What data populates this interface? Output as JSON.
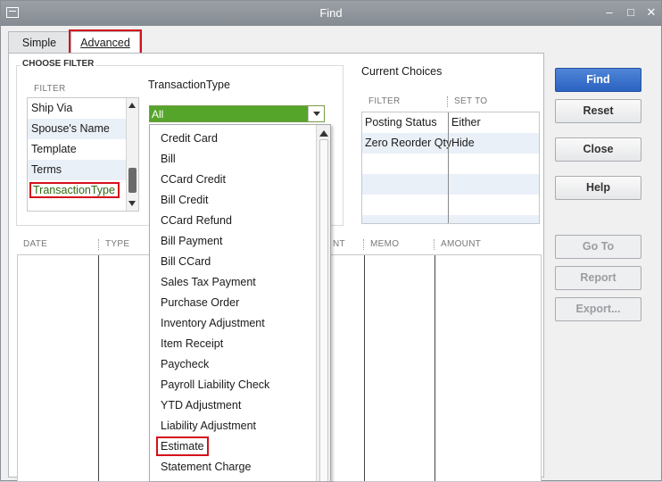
{
  "window": {
    "title": "Find"
  },
  "tabs": [
    {
      "label": "Simple"
    },
    {
      "label": "Advanced"
    }
  ],
  "choose_filter": {
    "group_label": "CHOOSE FILTER",
    "column_header": "FILTER",
    "items": [
      "Ship Via",
      "Spouse's Name",
      "Template",
      "Terms",
      "TransactionType"
    ],
    "selected": "TransactionType"
  },
  "transaction_type": {
    "label": "TransactionType",
    "selected_value": "All",
    "options": [
      "Credit Card",
      "Bill",
      "CCard Credit",
      "Bill Credit",
      "CCard Refund",
      "Bill Payment",
      "Bill CCard",
      "Sales Tax Payment",
      "Purchase Order",
      "Inventory Adjustment",
      "Item Receipt",
      "Paycheck",
      "Payroll Liability Check",
      "YTD Adjustment",
      "Liability Adjustment",
      "Estimate",
      "Statement Charge"
    ],
    "highlighted": "Estimate"
  },
  "current_choices": {
    "label": "Current Choices",
    "headers": {
      "filter": "FILTER",
      "set_to": "SET TO"
    },
    "rows": [
      {
        "filter": "Posting Status",
        "set_to": "Either"
      },
      {
        "filter": "Zero Reorder Qty",
        "set_to": "Hide"
      }
    ]
  },
  "results": {
    "headers": {
      "date": "DATE",
      "type": "TYPE",
      "account": "NT",
      "memo": "MEMO",
      "amount": "AMOUNT"
    }
  },
  "buttons": {
    "find": "Find",
    "reset": "Reset",
    "close": "Close",
    "help": "Help",
    "goto": "Go To",
    "report": "Report",
    "export": "Export..."
  },
  "colors": {
    "accent": "#2c62c1",
    "combo_green": "#55a52b",
    "highlight_red": "#d4111b"
  }
}
